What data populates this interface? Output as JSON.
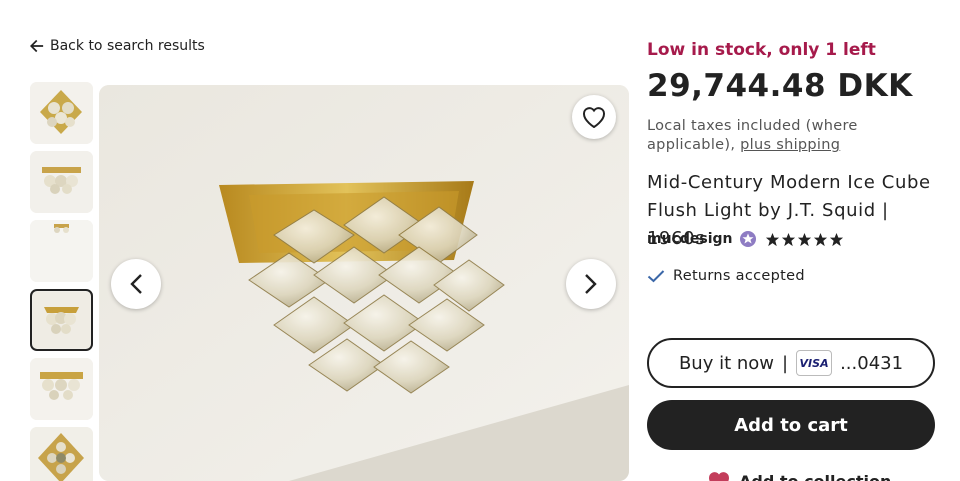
{
  "nav": {
    "back_label": "Back to search results"
  },
  "gallery": {
    "thumbnail_count": 6,
    "selected_index": 3
  },
  "listing": {
    "stock": "Low in stock, only 1 left",
    "price": "29,744.48 DKK",
    "taxes_prefix": "Local taxes included (where applicable),",
    "shipping_link": "plus shipping",
    "title": "Mid-Century Modern Ice Cube Flush Light by J.T. Squid | 1960s",
    "shop_name": "mucdesign",
    "star_rating": 5,
    "returns": "Returns accepted"
  },
  "actions": {
    "buy_now_label": "Buy it now",
    "buy_now_separator": "|",
    "card_brand": "VISA",
    "card_last_digits": "...0431",
    "add_to_cart_label": "Add to cart",
    "add_to_collection_label": "Add to collection"
  },
  "colors": {
    "stock_text": "#a61a4b",
    "primary_button": "#222222",
    "check_icon": "#3b67a8",
    "star": "#222222"
  },
  "icons": {
    "back": "arrow-left-icon",
    "favorite": "heart-icon",
    "prev": "chevron-left-icon",
    "next": "chevron-right-icon",
    "badge": "star-seller-badge-icon",
    "returns": "check-icon",
    "collection": "heart-filled-icon"
  }
}
